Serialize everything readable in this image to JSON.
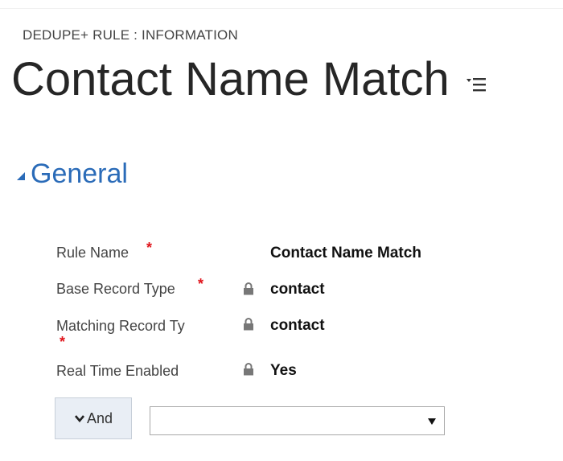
{
  "header": {
    "entity_label": "DEDUPE+ RULE : INFORMATION",
    "title": "Contact Name Match",
    "menu_icon": "list-menu-icon"
  },
  "section": {
    "title": "General",
    "collapse_icon": "collapse-triangle-icon"
  },
  "fields": [
    {
      "label": "Rule Name",
      "required": true,
      "locked": false,
      "value": "Contact Name Match"
    },
    {
      "label": "Base Record Type",
      "required": true,
      "locked": true,
      "value": "contact"
    },
    {
      "label": "Matching Record Ty",
      "required": true,
      "locked": true,
      "value": "contact"
    },
    {
      "label": "Real Time Enabled",
      "required": false,
      "locked": true,
      "value": "Yes"
    }
  ],
  "required_marker": "*",
  "condition": {
    "operator_label": "And",
    "operator_icon": "chevron-down-icon",
    "select_value": "",
    "select_icon": "dropdown-arrow-icon"
  },
  "colors": {
    "section_title": "#2a6bb8",
    "required": "#e0151c",
    "button_bg": "#e9eef5"
  }
}
